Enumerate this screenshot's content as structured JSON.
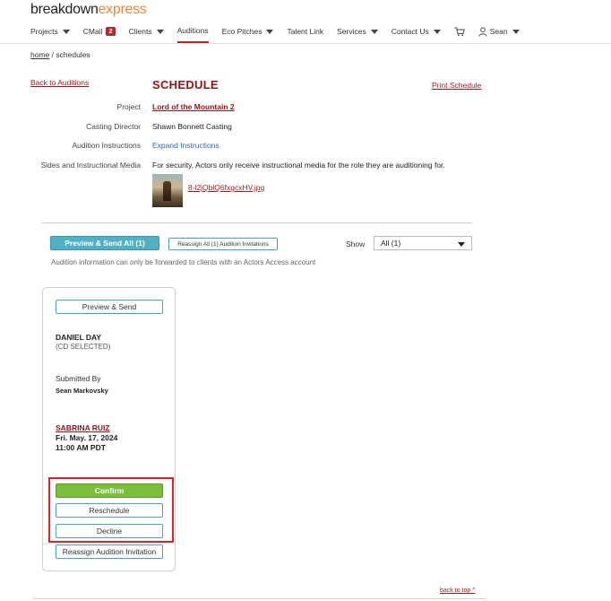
{
  "brand": {
    "part1": "breakdown",
    "part2": "express"
  },
  "nav": {
    "projects": "Projects",
    "cmail": "CMail",
    "cmail_count": "2",
    "clients": "Clients",
    "auditions": "Auditions",
    "eco_pitches": "Eco Pitches",
    "talent_link": "Talent Link",
    "services": "Services",
    "contact_us": "Contact Us",
    "user": "Sean"
  },
  "breadcrumb": {
    "home": "home",
    "separator": "/",
    "current": "schedules"
  },
  "header": {
    "back_link": "Back to Auditions",
    "title": "SCHEDULE",
    "print": "Print Schedule"
  },
  "details": {
    "project_label": "Project",
    "project_value": "Lord of the Mountain 2",
    "director_label": "Casting Director",
    "director_value": "Shawn Bonnett Casting",
    "instructions_label": "Audition Instructions",
    "instructions_value": "Expand Instructions",
    "media_label": "Sides and Instructional Media",
    "media_value": "For security, Actors only receive instructional media for the role they are auditioning for.",
    "media_file": "8-l2jQblQ6fxgcxHV.jpg"
  },
  "toolbar": {
    "preview_send_all": "Preview & Send All (1)",
    "reassign_all": "Reassign All (1) Audition Invitations",
    "show_label": "Show",
    "show_value": "All (1)",
    "note": "Audition information can only be forwarded to clients with an Actors Access account"
  },
  "card": {
    "preview_send": "Preview & Send",
    "talent_name": "DANIEL DAY",
    "talent_status": "(CD SELECTED)",
    "submitted_by_label": "Submitted By",
    "submitted_by_name": "Sean Markovsky",
    "appointment_name": "SABRINA RUIZ",
    "appointment_date": "Fri. May. 17, 2024",
    "appointment_time": "11:00 AM PDT",
    "confirm": "Confirm",
    "reschedule": "Reschedule",
    "decline": "Decline",
    "reassign": "Reassign Audition Invitation"
  },
  "footer": {
    "back_to_top": "back to top ^"
  },
  "colors": {
    "brand_accent": "#e8873a",
    "link_red": "#9b1b1f",
    "teal": "#4fb0c6",
    "confirm_green": "#7cbf3a",
    "highlight": "#e0202a"
  }
}
